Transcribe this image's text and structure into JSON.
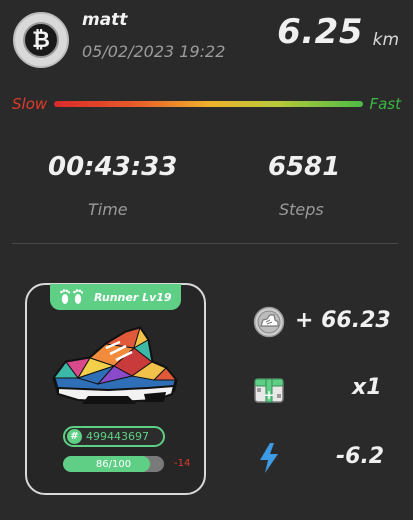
{
  "header": {
    "username": "matt",
    "datetime": "05/02/2023 19:22",
    "distance": "6.25",
    "distance_unit": "km",
    "avatar_icon": "bitcoin-icon"
  },
  "speed": {
    "slow_label": "Slow",
    "fast_label": "Fast"
  },
  "stats": {
    "time_value": "00:43:33",
    "time_label": "Time",
    "steps_value": "6581",
    "steps_label": "Steps"
  },
  "sneaker": {
    "type_label": "Runner Lv19",
    "badge_icon": "footprints-icon",
    "id_symbol": "#",
    "id": "499443697",
    "durability_text": "86/100",
    "durability_fraction": 0.86,
    "durability_delta": "-14",
    "accent_color": "#5fcf86"
  },
  "rewards": {
    "gst_value": "+ 66.23",
    "gst_icon": "coin-shoe-icon",
    "mystery_box_value": "x1",
    "mystery_box_icon": "mystery-box-icon",
    "energy_value": "-6.2",
    "energy_icon": "lightning-icon",
    "energy_color": "#3d9be6"
  }
}
